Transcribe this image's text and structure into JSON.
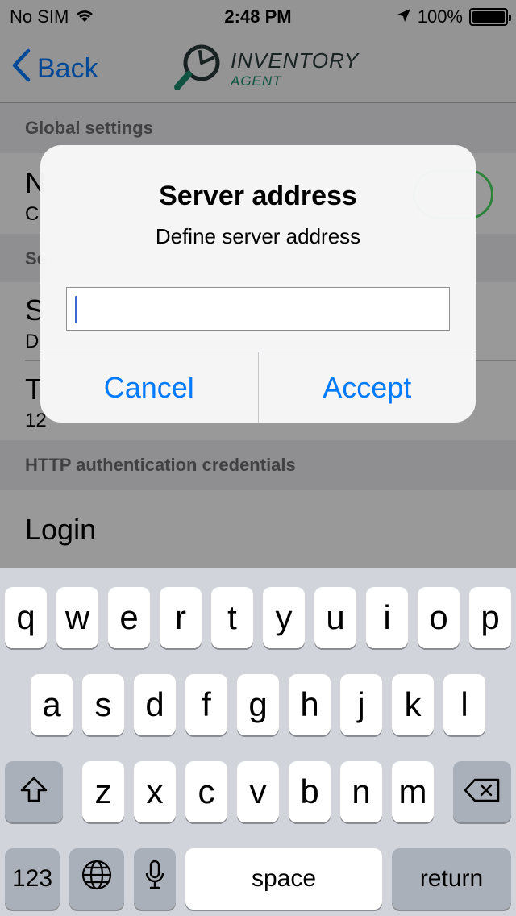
{
  "status_bar": {
    "carrier": "No SIM",
    "time": "2:48 PM",
    "battery": "100%",
    "battery_level": 1.0,
    "icons": [
      "wifi-icon",
      "location-arrow-icon",
      "battery-icon"
    ]
  },
  "nav": {
    "back_label": "Back",
    "logo_title": "INVENTORY",
    "logo_subtitle": "AGENT"
  },
  "settings": {
    "global_header": "Global settings",
    "global_cell_title": "N",
    "global_cell_sub": "C",
    "server_header": "Se",
    "server_cell_title": "S",
    "server_cell_sub": "D",
    "timeout_cell_title": "T",
    "timeout_cell_sub": "12",
    "http_header": "HTTP authentication credentials",
    "login_label": "Login"
  },
  "alert": {
    "title": "Server address",
    "message": "Define server address",
    "input_value": "",
    "cancel_label": "Cancel",
    "accept_label": "Accept"
  },
  "keyboard": {
    "row1": [
      "q",
      "w",
      "e",
      "r",
      "t",
      "y",
      "u",
      "i",
      "o",
      "p"
    ],
    "row2": [
      "a",
      "s",
      "d",
      "f",
      "g",
      "h",
      "j",
      "k",
      "l"
    ],
    "row3": [
      "z",
      "x",
      "c",
      "v",
      "b",
      "n",
      "m"
    ],
    "numbers_label": "123",
    "space_label": "space",
    "return_label": "return"
  },
  "colors": {
    "accent": "#007aff",
    "toggle_on": "#4cd964",
    "logo_green": "#1a8a6c"
  }
}
